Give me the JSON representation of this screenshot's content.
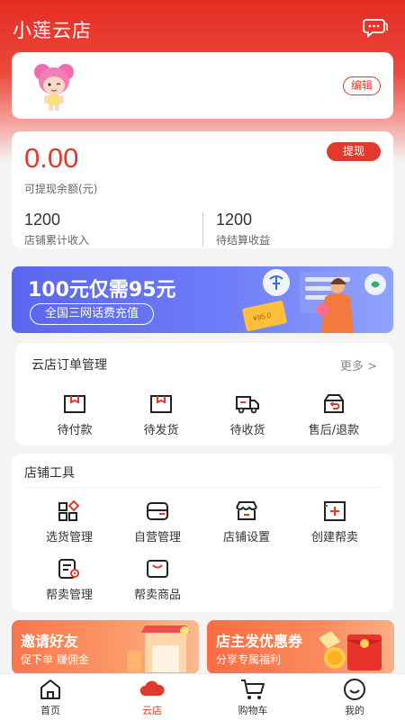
{
  "app": {
    "title": "小莲云店"
  },
  "profile": {
    "edit_label": "编辑"
  },
  "balance": {
    "amount": "0.00",
    "label": "可提现余额(元)",
    "withdraw_label": "提现",
    "stats": [
      {
        "value": "1200",
        "label": "店铺累计收入"
      },
      {
        "value": "1200",
        "label": "待结算收益"
      }
    ]
  },
  "banner": {
    "main_text": "100元仅需95元",
    "sub_text": "全国三网话费充值",
    "coupon_text": "¥95.0"
  },
  "orders": {
    "title": "云店订单管理",
    "more": "更多 >",
    "items": [
      {
        "label": "待付款",
        "icon": "pending-payment-icon"
      },
      {
        "label": "待发货",
        "icon": "pending-shipment-icon"
      },
      {
        "label": "待收货",
        "icon": "pending-receipt-icon"
      },
      {
        "label": "售后/退款",
        "icon": "refund-icon"
      }
    ]
  },
  "tools": {
    "title": "店铺工具",
    "items": [
      {
        "label": "选货管理",
        "icon": "product-selection-icon"
      },
      {
        "label": "自营管理",
        "icon": "self-operated-icon"
      },
      {
        "label": "店铺设置",
        "icon": "store-settings-icon"
      },
      {
        "label": "创建帮卖",
        "icon": "create-resell-icon"
      },
      {
        "label": "帮卖管理",
        "icon": "resell-management-icon"
      },
      {
        "label": "帮卖商品",
        "icon": "resell-goods-icon"
      }
    ]
  },
  "promos": [
    {
      "title": "邀请好友",
      "subtitle": "促下单 赚佣金"
    },
    {
      "title": "店主发优惠券",
      "subtitle": "分享专属福利"
    }
  ],
  "tabbar": {
    "active": "云店",
    "items": [
      {
        "label": "首页",
        "icon": "home-icon"
      },
      {
        "label": "云店",
        "icon": "cloud-store-icon"
      },
      {
        "label": "购物车",
        "icon": "cart-icon"
      },
      {
        "label": "我的",
        "icon": "profile-icon"
      }
    ]
  },
  "colors": {
    "brand": "#e03a2e",
    "banner": "#6d7cf8",
    "promo": "#fb8a5d"
  }
}
